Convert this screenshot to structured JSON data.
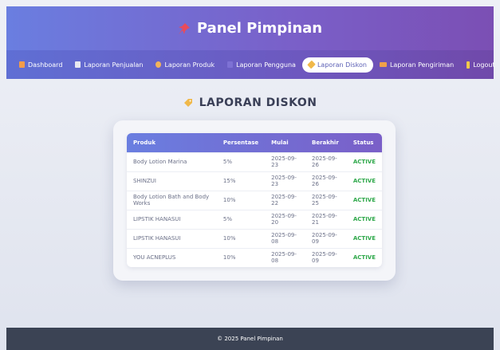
{
  "header": {
    "title": "Panel Pimpinan",
    "icon": "pin-icon",
    "icon_color": "#e94b5a"
  },
  "nav": {
    "items": [
      {
        "label": "Dashboard",
        "icon": "dashboard-icon",
        "icon_color": "#f39c4a",
        "active": false
      },
      {
        "label": "Laporan Penjualan",
        "icon": "document-icon",
        "icon_color": "#e8e8f0",
        "active": false
      },
      {
        "label": "Laporan Produk",
        "icon": "product-icon",
        "icon_color": "#f2b35a",
        "active": false
      },
      {
        "label": "Laporan Pengguna",
        "icon": "users-icon",
        "icon_color": "#8a7fe0",
        "active": false
      },
      {
        "label": "Laporan Diskon",
        "icon": "tag-icon",
        "icon_color": "#f0b84a",
        "active": true
      },
      {
        "label": "Laporan Pengiriman",
        "icon": "truck-icon",
        "icon_color": "#f0a04a",
        "active": false
      },
      {
        "label": "Logout",
        "icon": "logout-icon",
        "icon_color": "#f2c94a",
        "active": false
      }
    ]
  },
  "page": {
    "title": "LAPORAN DISKON",
    "icon": "tag-icon",
    "icon_color": "#f0b84a"
  },
  "table": {
    "headers": [
      "Produk",
      "Persentase",
      "Mulai",
      "Berakhir",
      "Status"
    ],
    "rows": [
      [
        "Body Lotion Marina",
        "5%",
        "2025-09-23",
        "2025-09-26",
        "ACTIVE"
      ],
      [
        "SHINZUI",
        "15%",
        "2025-09-23",
        "2025-09-26",
        "ACTIVE"
      ],
      [
        "Body Lotion Bath and Body Works",
        "10%",
        "2025-09-22",
        "2025-09-25",
        "ACTIVE"
      ],
      [
        "LIPSTIK HANASUI",
        "5%",
        "2025-09-20",
        "2025-09-21",
        "ACTIVE"
      ],
      [
        "LIPSTIK HANASUI",
        "10%",
        "2025-09-08",
        "2025-09-09",
        "ACTIVE"
      ],
      [
        "YOU ACNEPLUS",
        "10%",
        "2025-09-08",
        "2025-09-09",
        "ACTIVE"
      ]
    ],
    "status_color": "#2ea84a"
  },
  "footer": {
    "text": "© 2025 Panel Pimpinan"
  }
}
